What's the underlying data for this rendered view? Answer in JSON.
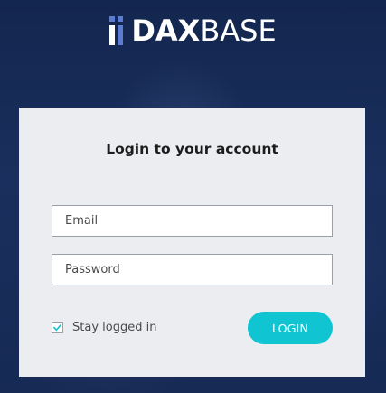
{
  "brand": {
    "logo_part1": "DAX",
    "logo_part2": "BASE",
    "accent_color": "#10c4d1",
    "mark_color": "#5c7ccf"
  },
  "login": {
    "title": "Login to your account",
    "email_placeholder": "Email",
    "email_value": "",
    "password_placeholder": "Password",
    "password_value": "",
    "remember_label": "Stay logged in",
    "remember_checked": true,
    "submit_label": "LOGIN"
  }
}
